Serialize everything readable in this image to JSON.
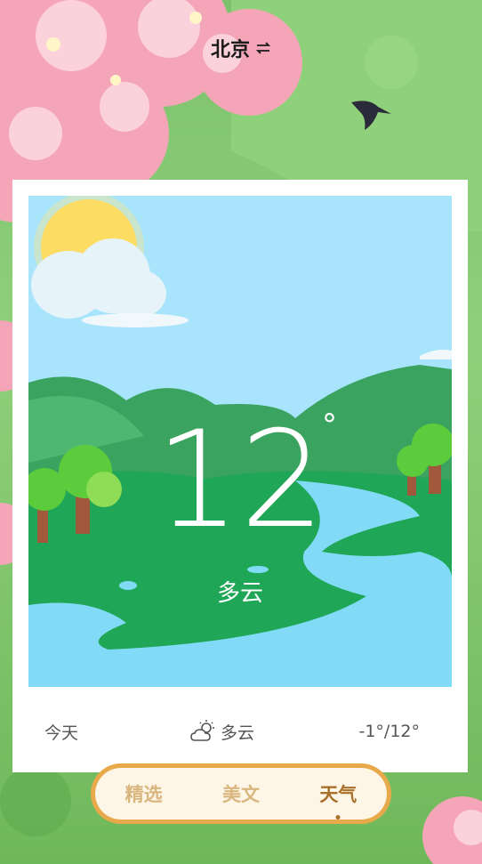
{
  "header": {
    "city": "北京",
    "swap_icon": "swap-icon"
  },
  "weather": {
    "temperature": "12",
    "degree_symbol": "°",
    "condition": "多云"
  },
  "forecast": {
    "day": "今天",
    "icon": "partly-cloudy-icon",
    "condition": "多云",
    "range": "-1°/12°"
  },
  "tabs": [
    {
      "label": "精选",
      "active": false
    },
    {
      "label": "美文",
      "active": false
    },
    {
      "label": "天气",
      "active": true
    }
  ],
  "colors": {
    "tab_border": "#e8a94a",
    "tab_active": "#a8702a",
    "tab_inactive": "#d9b67e",
    "sky": "#a8e4fb",
    "grass": "#1fa656"
  }
}
